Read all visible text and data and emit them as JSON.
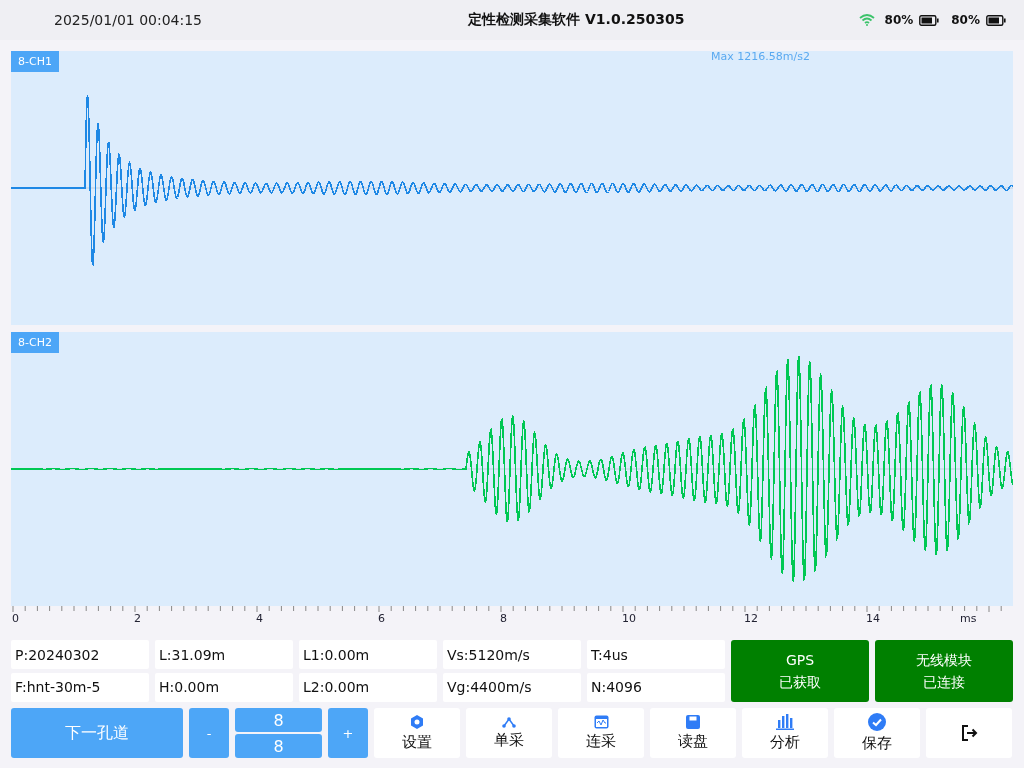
{
  "status_bar": {
    "datetime": "2025/01/01 00:04:15",
    "title": "定性检测采集软件 V1.0.250305",
    "battery_level": "80%",
    "battery_level_2": "80%"
  },
  "channels": [
    {
      "label": "8-CH1",
      "max": "Max 1216.58m/s2",
      "color": "#1e88e5",
      "kind": "decay"
    },
    {
      "label": "8-CH2",
      "color": "#00c853",
      "kind": "burst"
    }
  ],
  "axis": {
    "ticks": [
      "0",
      "2",
      "4",
      "6",
      "8",
      "10",
      "12",
      "14"
    ],
    "unit": "ms"
  },
  "params": [
    {
      "text": "P:20240302"
    },
    {
      "text": "L:31.09m"
    },
    {
      "text": "L1:0.00m"
    },
    {
      "text": "Vs:5120m/s"
    },
    {
      "text": "T:4us"
    },
    {
      "text": "F:hnt-30m-5"
    },
    {
      "text": "H:0.00m"
    },
    {
      "text": "L2:0.00m"
    },
    {
      "text": "Vg:4400m/s"
    },
    {
      "text": "N:4096"
    }
  ],
  "status_cards": [
    {
      "title": "GPS",
      "state": "已获取"
    },
    {
      "title": "无线模块",
      "state": "已连接"
    }
  ],
  "controls": {
    "next": "下一孔道",
    "minus": "-",
    "values": [
      "8",
      "8"
    ],
    "plus": "+"
  },
  "toolbar": [
    {
      "kind": "settings",
      "label": "设置"
    },
    {
      "kind": "single",
      "label": "单采"
    },
    {
      "kind": "continuous",
      "label": "连采"
    },
    {
      "kind": "disk",
      "label": "读盘"
    },
    {
      "kind": "analysis",
      "label": "分析"
    },
    {
      "kind": "save",
      "label": "保存"
    },
    {
      "kind": "exit"
    }
  ]
}
